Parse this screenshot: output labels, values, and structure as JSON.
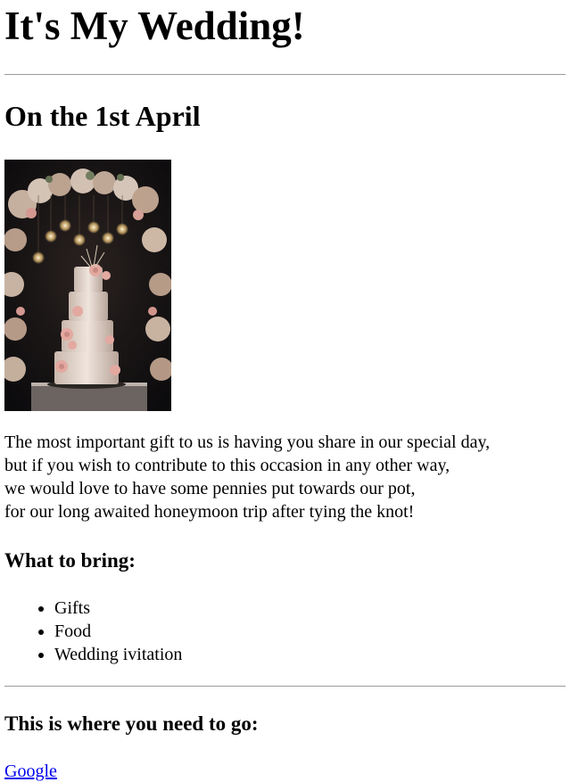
{
  "page": {
    "title": "It's My Wedding!",
    "date_heading": "On the 1st April",
    "photo_alt": "wedding-cake-photo",
    "intro_lines": [
      "The most important gift to us is having you share in our special day,",
      "but if you wish to contribute to this occasion in any other way,",
      "we would love to have some pennies put towards our pot,",
      "for our long awaited honeymoon trip after tying the knot!"
    ],
    "bring_heading": "What to bring:",
    "bring_items": [
      "Gifts",
      "Food",
      "Wedding ivitation"
    ],
    "go_heading": "This is where you need to go:",
    "link_label": "Google"
  },
  "colors": {
    "link": "#0000ee",
    "rule": "#9a9a9a"
  }
}
